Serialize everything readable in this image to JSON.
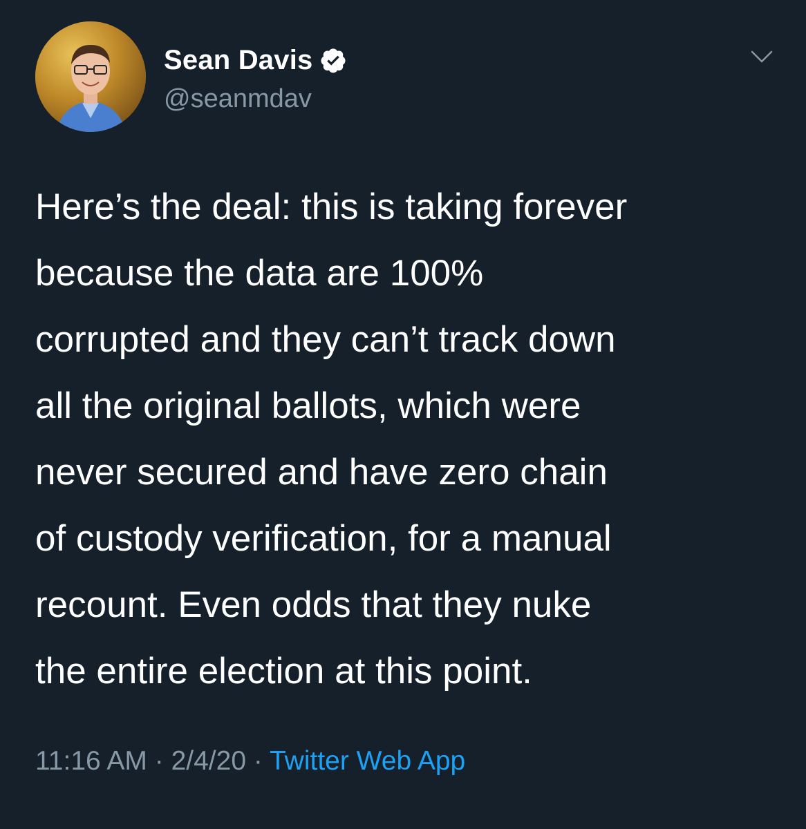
{
  "author": {
    "display_name": "Sean Davis",
    "handle": "@seanmdav",
    "verified": true,
    "avatar": "profile-photo"
  },
  "tweet": {
    "lines": [
      "Here’s the deal: this is taking forever",
      "because the data are 100%",
      "corrupted and they can’t track down",
      "all the original ballots, which were",
      "never secured and have zero chain",
      "of custody verification, for a manual",
      "recount. Even odds that they nuke",
      "the entire election at this point."
    ]
  },
  "meta": {
    "time": "11:16 AM",
    "separator": "·",
    "date": "2/4/20",
    "source": "Twitter Web App"
  },
  "icons": {
    "verified": "verified-badge-icon",
    "menu": "chevron-down-icon"
  },
  "colors": {
    "background": "#15202b",
    "text": "#ffffff",
    "secondary_text": "#8899a6",
    "link": "#1da1f2"
  }
}
